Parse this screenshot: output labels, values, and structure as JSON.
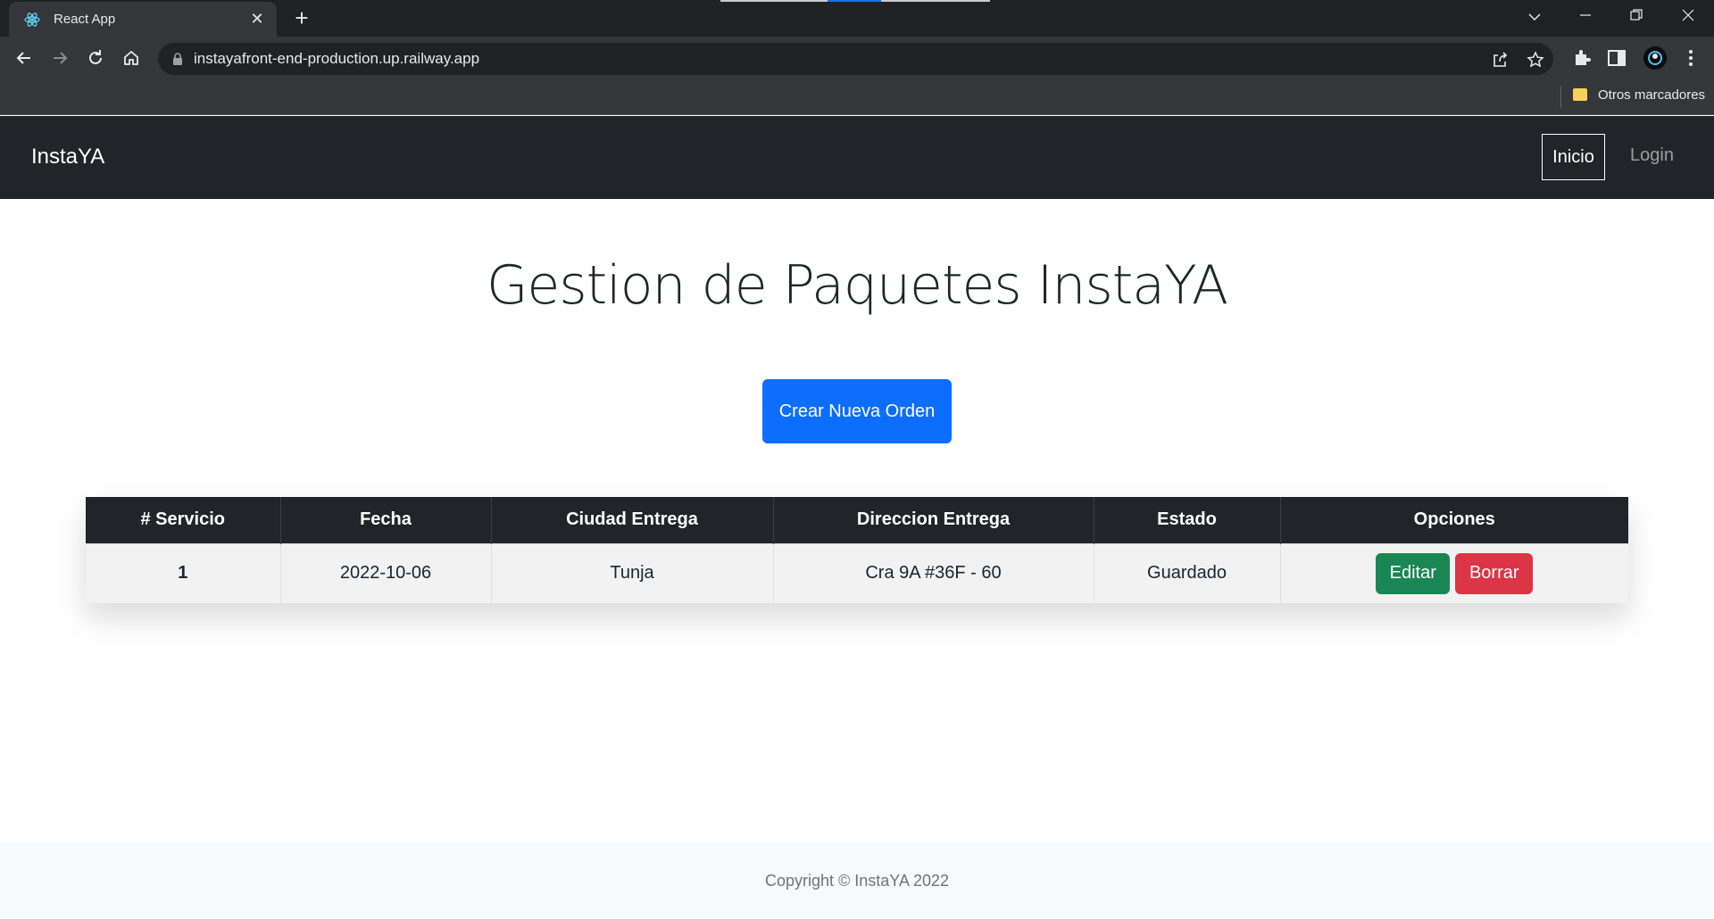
{
  "browser": {
    "tab_title": "React App",
    "url": "instayafront-end-production.up.railway.app",
    "bookmark_folder": "Otros marcadores"
  },
  "navbar": {
    "brand": "InstaYA",
    "links": [
      "Inicio",
      "Login"
    ]
  },
  "main": {
    "title": "Gestion de Paquetes InstaYA",
    "create_button": "Crear Nueva Orden"
  },
  "table": {
    "headers": [
      "# Servicio",
      "Fecha",
      "Ciudad Entrega",
      "Direccion Entrega",
      "Estado",
      "Opciones"
    ],
    "rows": [
      {
        "servicio": "1",
        "fecha": "2022-10-06",
        "ciudad": "Tunja",
        "direccion": "Cra 9A #36F - 60",
        "estado": "Guardado",
        "edit_label": "Editar",
        "delete_label": "Borrar"
      }
    ]
  },
  "footer": {
    "text": "Copyright © InstaYA 2022"
  },
  "colors": {
    "primary": "#0d6efd",
    "success": "#198754",
    "danger": "#dc3545",
    "dark": "#212529"
  }
}
